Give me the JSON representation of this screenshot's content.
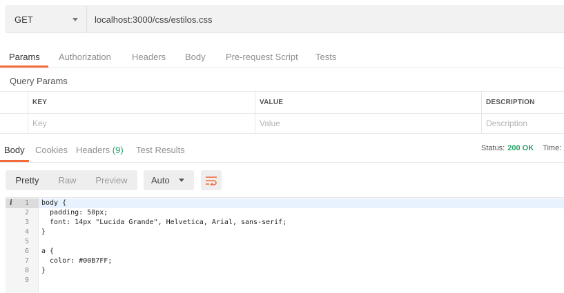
{
  "request": {
    "method": "GET",
    "url": "localhost:3000/css/estilos.css"
  },
  "request_tabs": [
    "Params",
    "Authorization",
    "Headers",
    "Body",
    "Pre-request Script",
    "Tests"
  ],
  "query_params": {
    "title": "Query Params",
    "columns": [
      "KEY",
      "VALUE",
      "DESCRIPTION"
    ],
    "placeholders": [
      "Key",
      "Value",
      "Description"
    ]
  },
  "response_tabs": {
    "body": "Body",
    "cookies": "Cookies",
    "headers": "Headers",
    "headers_count": "(9)",
    "test_results": "Test Results"
  },
  "status": {
    "label": "Status:",
    "code": "200 OK",
    "time_label": "Time:"
  },
  "view_modes": [
    "Pretty",
    "Raw",
    "Preview"
  ],
  "format": "Auto",
  "editor": {
    "lines": [
      "body {",
      "  padding: 50px;",
      "  font: 14px \"Lucida Grande\", Helvetica, Arial, sans-serif;",
      "}",
      "",
      "a {",
      "  color: #00B7FF;",
      "}",
      ""
    ],
    "line_numbers": [
      "1",
      "2",
      "3",
      "4",
      "5",
      "6",
      "7",
      "8",
      "9"
    ]
  },
  "colors": {
    "accent": "#f26b3a",
    "status_ok": "#26a269"
  }
}
